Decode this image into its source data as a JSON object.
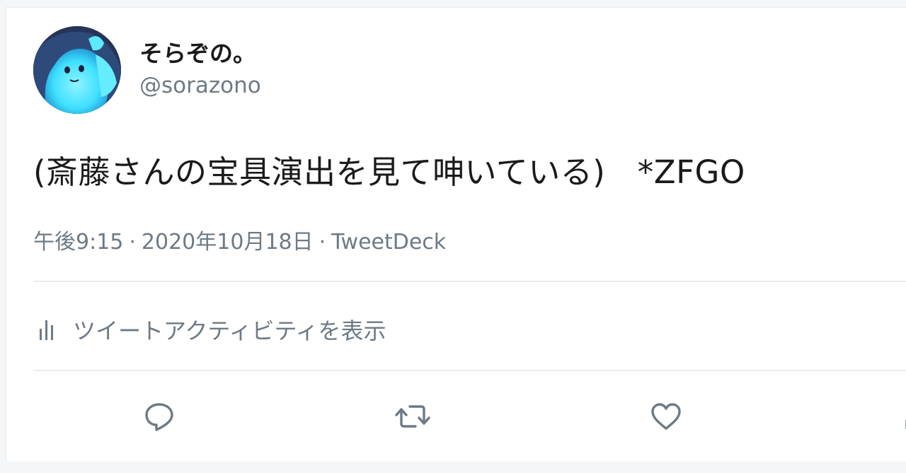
{
  "tweet": {
    "display_name": "そらぞの。",
    "handle": "@sorazono",
    "text": "(斎藤さんの宝具演出を見て呻いている)　*ZFGO",
    "time": "午後9:15",
    "separator": "·",
    "date": "2020年10月18日",
    "source": "TweetDeck",
    "activity_label": "ツイートアクティビティを表示"
  },
  "icons": {
    "avatar": "avatar-character",
    "activity": "bar-chart-icon",
    "reply": "reply-icon",
    "retweet": "retweet-icon",
    "like": "heart-icon",
    "share": "share-icon"
  },
  "colors": {
    "text_primary": "#1a1a1a",
    "text_secondary": "#6e7a85",
    "avatar_accent": "#38e1ff",
    "divider": "#e8ecef"
  }
}
